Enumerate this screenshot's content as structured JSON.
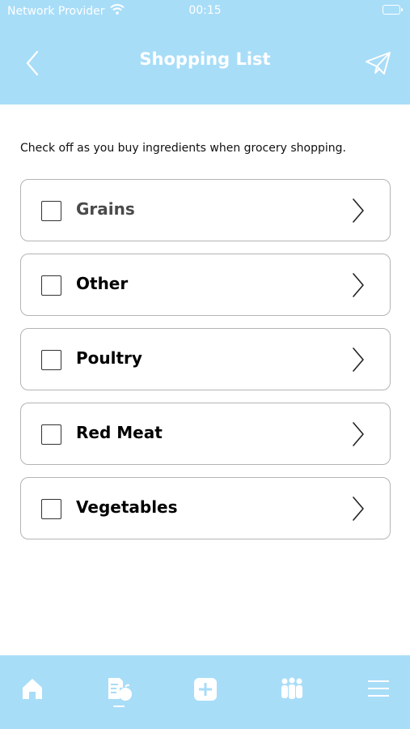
{
  "status_bar": {
    "carrier": "Network Provider",
    "time": "00:15"
  },
  "header": {
    "title": "Shopping List"
  },
  "intro": "Check off as you buy ingredients when grocery shopping.",
  "categories": [
    {
      "label": "Grains",
      "checked": false
    },
    {
      "label": "Other",
      "checked": false
    },
    {
      "label": "Poultry",
      "checked": false
    },
    {
      "label": "Red Meat",
      "checked": false
    },
    {
      "label": "Vegetables",
      "checked": false
    }
  ],
  "tabbar": {
    "tabs": [
      {
        "icon": "home-icon",
        "active": false
      },
      {
        "icon": "recipe-list-icon",
        "active": true
      },
      {
        "icon": "add-icon",
        "active": false
      },
      {
        "icon": "people-icon",
        "active": false
      },
      {
        "icon": "menu-icon",
        "active": false
      }
    ]
  },
  "colors": {
    "header_bg": "#a8ddf8",
    "tabbar_bg": "#a8ddf8",
    "border": "#b4b4b4"
  }
}
